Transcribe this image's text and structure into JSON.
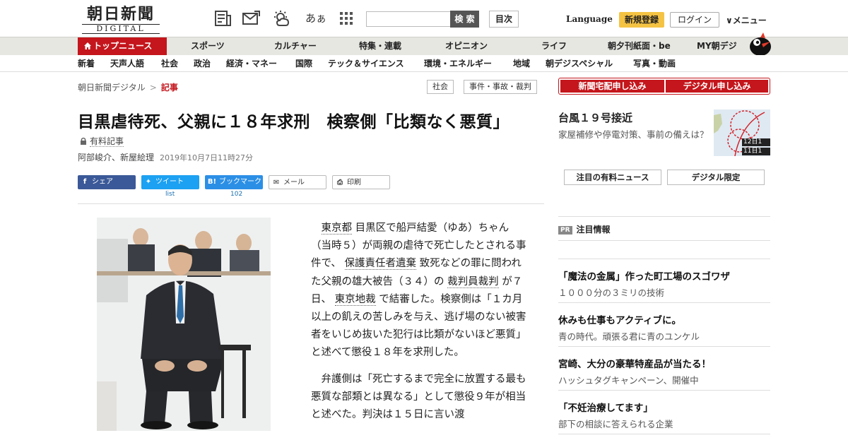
{
  "header": {
    "logo_line1": "朝日新聞",
    "logo_line2": "DIGITAL",
    "search_button": "検 索",
    "index_button": "目次",
    "language": "Language",
    "signup": "新規登録",
    "login": "ログイン",
    "menu": "∨メニュー",
    "font_size_icon_text": "あぁ"
  },
  "main_nav": [
    {
      "label": "トップニュース"
    },
    {
      "label": "スポーツ"
    },
    {
      "label": "カルチャー"
    },
    {
      "label": "特集・連載"
    },
    {
      "label": "オピニオン"
    },
    {
      "label": "ライフ"
    },
    {
      "label": "朝夕刊紙面・be"
    },
    {
      "label": "MY朝デジ"
    }
  ],
  "sub_nav": [
    {
      "label": "新着"
    },
    {
      "label": "天声人語"
    },
    {
      "label": "社会"
    },
    {
      "label": "政治"
    },
    {
      "label": "経済・マネー"
    },
    {
      "label": "国際"
    },
    {
      "label": "テック＆サイエンス"
    },
    {
      "label": "環境・エネルギー"
    },
    {
      "label": "地域"
    },
    {
      "label": "朝デジスペシャル"
    },
    {
      "label": "写真・動画"
    }
  ],
  "breadcrumb": {
    "home": "朝日新聞デジタル",
    "sep": ">",
    "current": "記事"
  },
  "tags": [
    "社会",
    "事件・事故・裁判"
  ],
  "article": {
    "headline": "目黒虐待死、父親に１８年求刑　検察側「比類なく悪質」",
    "paid_label": "有料記事",
    "authors": "阿部峻介、新屋絵理",
    "date": "2019年10月7日11時27分",
    "p1": {
      "a": "東京都",
      "b": "目黒区で船戸結愛（ゆあ）ちゃん（当時５）が両親の虐待で死亡したとされる事件で、",
      "c": "保護責任者遺棄",
      "d": "致死などの罪に問われた父親の雄大被告（３４）の",
      "e": "裁判員裁判",
      "f": "が７日、",
      "g": "東京地裁",
      "h": "で結審した。検察側は「１カ月以上の飢えの苦しみを与え、逃げ場のない被害者をいじめ抜いた犯行は比類がないほど悪質」と述べて懲役１８年を求刑した。"
    },
    "p2": "弁護側は「死亡するまで完全に放置する最も悪質な部類とは異なる」として懲役９年が相当と述べた。判決は１５日に言い渡"
  },
  "share": {
    "facebook": "シェア",
    "twitter": "ツイート",
    "twitter_count": "list",
    "hatena": "ブックマーク",
    "hatena_count": "102",
    "mail": "メール",
    "print": "印刷"
  },
  "sidebar": {
    "subscribe_paper": "新聞宅配申し込み",
    "subscribe_digital": "デジタル申し込み",
    "typhoon_title": "台風１９号接近",
    "typhoon_desc": "家屋補修や停電対策、事前の備えは？",
    "map_label_1": "12日1",
    "map_label_2": "11日1",
    "tab_paid_news": "注目の有料ニュース",
    "tab_digital_limited": "デジタル限定",
    "pr_badge": "PR",
    "pr_heading": "注目情報",
    "pr_items": [
      {
        "title": "「魔法の金属」作った町工場のスゴワザ",
        "desc": "１０００分の３ミリの技術"
      },
      {
        "title": "休みも仕事もアクティブに。",
        "desc": "青の時代。頑張る君に青のユンケル"
      },
      {
        "title": "宮崎、大分の豪華特産品が当たる！",
        "desc": "ハッシュタグキャンペーン、開催中"
      },
      {
        "title": "「不妊治療してます」",
        "desc": "部下の相談に答えられる企業"
      }
    ]
  },
  "colors": {
    "brand_red": "#c4161c",
    "signup_yellow": "#f5c343",
    "nav_gray": "#e7e7e2"
  }
}
